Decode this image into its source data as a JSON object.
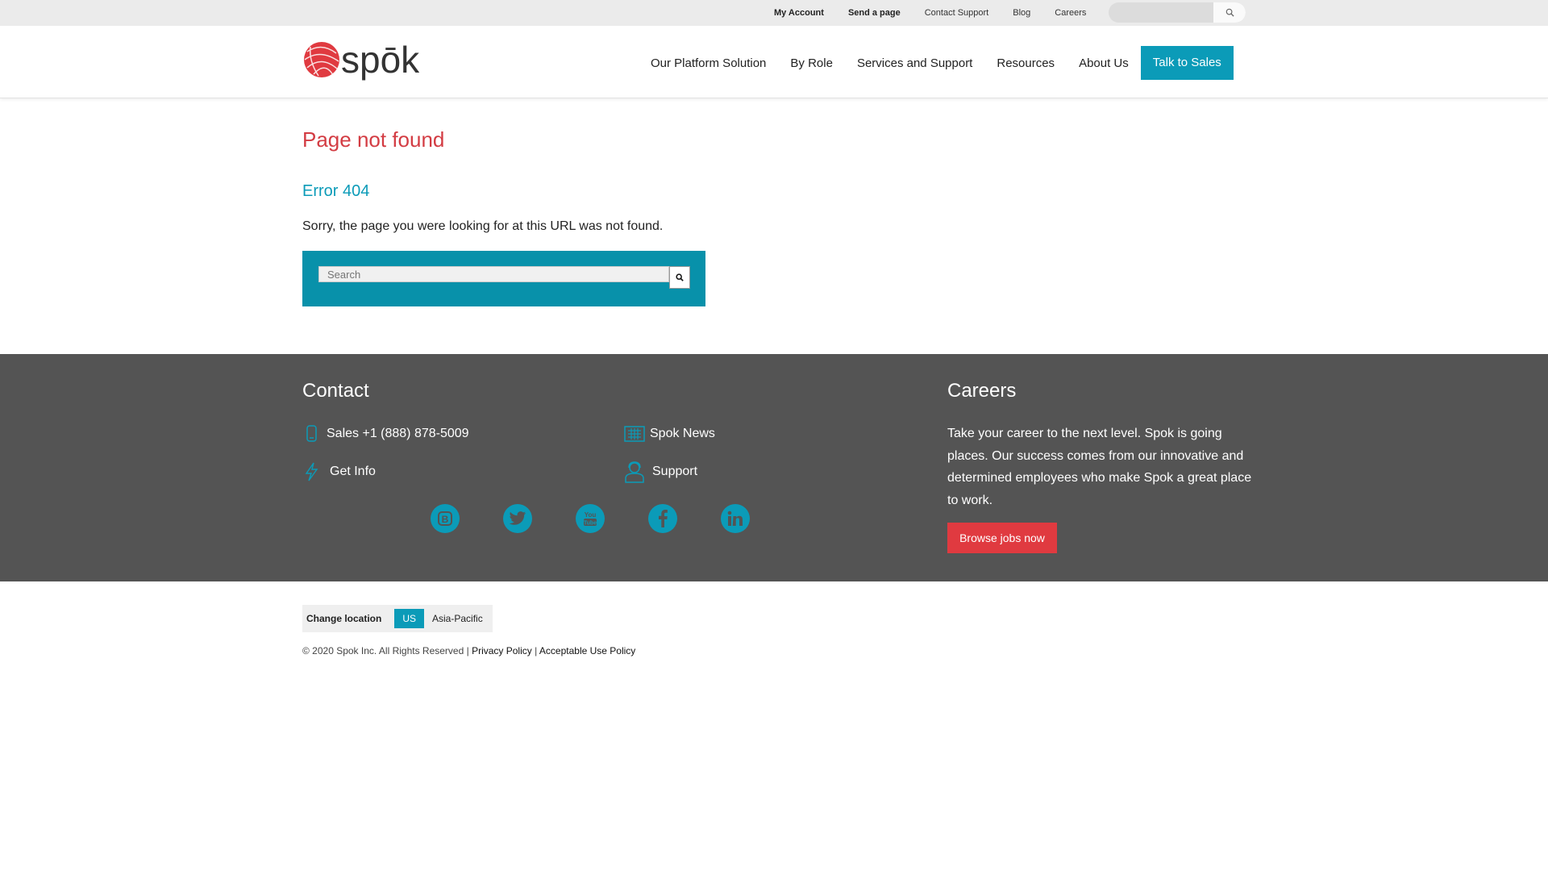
{
  "utility_bar": {
    "links": [
      "My Account",
      "Send a page",
      "Contact Support",
      "Blog",
      "Careers"
    ],
    "search_placeholder": "",
    "search_icon": "search-icon"
  },
  "header": {
    "logo_text": "spōk",
    "nav": [
      "Our Platform Solution",
      "By Role",
      "Services and Support",
      "Resources",
      "About Us"
    ],
    "cta": "Talk to Sales"
  },
  "main": {
    "title": "Page not found",
    "subtitle": "Error 404",
    "message": "Sorry, the page you were looking for at this URL was not found.",
    "search_placeholder": "Search",
    "search_icon": "search-icon"
  },
  "footer": {
    "contact_heading": "Contact",
    "sales": "Sales +1 (888) 878-5009",
    "get_info": "Get Info",
    "news": "Spok News",
    "support": "Support",
    "careers_heading": "Careers",
    "careers_text": "Take your career to the next level. Spok is going places. Our success comes from our innovative and determined employees who make Spok a great place to work.",
    "jobs_button": "Browse jobs now",
    "social": [
      "blog-icon",
      "twitter-icon",
      "youtube-icon",
      "facebook-icon",
      "linkedin-icon"
    ],
    "icon_color": "#0b9bb8"
  },
  "bottom": {
    "change_location": "Change location",
    "us": "US",
    "asia_pacific": "Asia-Pacific",
    "copyright": "© 2020 Spok Inc. All Rights Reserved |",
    "privacy": "Privacy Policy",
    "separator": "|",
    "acceptable_use": "Acceptable Use Policy"
  },
  "colors": {
    "accent": "#0b9bb8",
    "brand_red": "#d33c43",
    "footer_bg": "#545454"
  }
}
